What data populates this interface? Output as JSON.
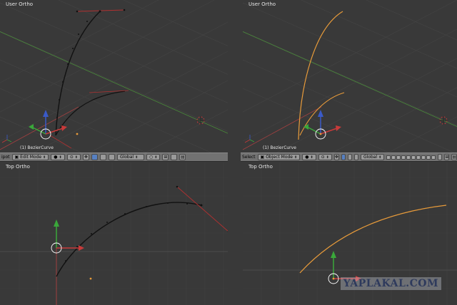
{
  "viewports": {
    "top_left": {
      "label": "User Ortho",
      "object_label": "(1) BezierCurve"
    },
    "top_right": {
      "label": "User Ortho",
      "object_label": "(1) BezierCurve"
    },
    "bottom_left": {
      "label": "Top Ortho"
    },
    "bottom_right": {
      "label": "Top Ortho"
    }
  },
  "toolbar_left": {
    "menu_fragment": "ipot",
    "mode": "Edit Mode",
    "orientation": "Global"
  },
  "toolbar_right": {
    "menu_fragment": "Select",
    "mode": "Object Mode",
    "orientation": "Global"
  },
  "watermark": "YAPLAKAL.COM",
  "colors": {
    "viewport_bg": "#393939",
    "grid": "#444444",
    "x_axis": "#a04040",
    "y_axis": "#4a8a3a",
    "curve_edit": "#111111",
    "curve_object": "#e89b3a",
    "handle": "#b03030",
    "toolbar_bg": "#727272",
    "selected_button": "#5680c2"
  },
  "icons": [
    "mode-icon",
    "shading-icon",
    "pivot-icon",
    "manipulator-icon",
    "layers-icon",
    "snap-icon",
    "render-icon"
  ]
}
